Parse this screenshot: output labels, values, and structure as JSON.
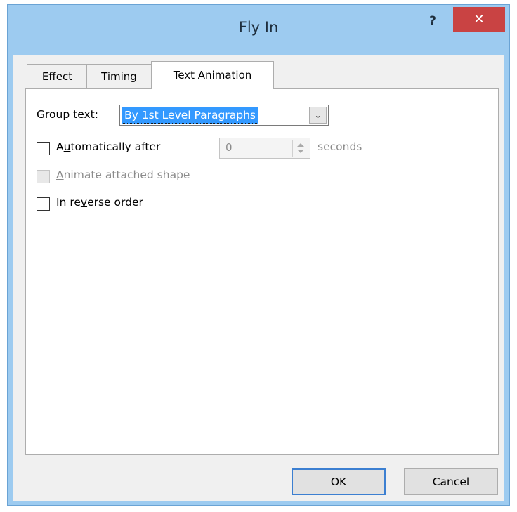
{
  "window": {
    "title": "Fly In",
    "help_label": "?",
    "close_label": "✕"
  },
  "tabs": [
    {
      "label": "Effect",
      "active": false
    },
    {
      "label": "Timing",
      "active": false
    },
    {
      "label": "Text Animation",
      "active": true
    }
  ],
  "group_text": {
    "label_pre": "",
    "label_mnemonic": "G",
    "label_post": "roup text:",
    "selected_value": "By 1st Level Paragraphs",
    "arrow": "⌄"
  },
  "automatically_after": {
    "label_pre": "A",
    "label_mnemonic": "u",
    "label_post": "tomatically after",
    "checked": false,
    "value": "0",
    "unit": "seconds"
  },
  "animate_attached_shape": {
    "label_pre": "",
    "label_mnemonic": "A",
    "label_post": "nimate attached shape",
    "checked": false,
    "enabled": false
  },
  "reverse_order": {
    "label_pre": "In re",
    "label_mnemonic": "v",
    "label_post": "erse order",
    "checked": false
  },
  "buttons": {
    "ok": "OK",
    "cancel": "Cancel"
  }
}
